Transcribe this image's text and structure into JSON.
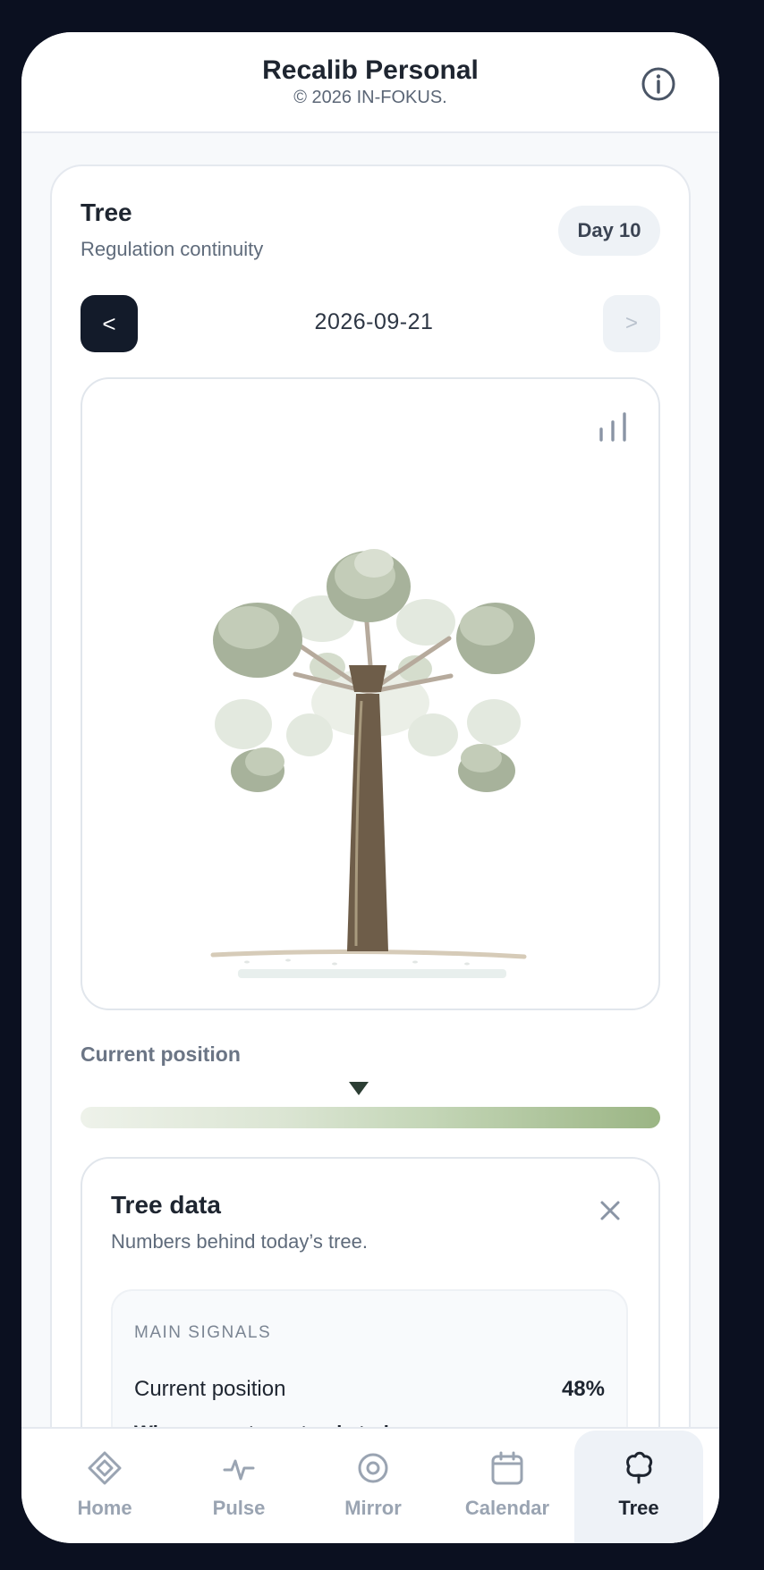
{
  "app": {
    "title": "Recalib Personal",
    "copyright": "© 2026 IN-FOKUS."
  },
  "tree_card": {
    "title": "Tree",
    "subtitle": "Regulation continuity",
    "day_badge": "Day 10",
    "prev_label": "<",
    "next_label": ">",
    "date": "2026-09-21"
  },
  "position": {
    "label": "Current position",
    "value_percent": 48
  },
  "tree_data": {
    "title": "Tree data",
    "subtitle": "Numbers behind today’s tree.",
    "section_heading": "MAIN SIGNALS",
    "signals": [
      {
        "name": "Current position",
        "value": "48%",
        "description": "Where your tree stands today."
      }
    ]
  },
  "tabbar": {
    "tabs": [
      {
        "label": "Home",
        "icon": "diamond-icon",
        "active": false
      },
      {
        "label": "Pulse",
        "icon": "pulse-icon",
        "active": false
      },
      {
        "label": "Mirror",
        "icon": "eye-icon",
        "active": false
      },
      {
        "label": "Calendar",
        "icon": "calendar-icon",
        "active": false
      },
      {
        "label": "Tree",
        "icon": "tree-icon",
        "active": true
      }
    ]
  },
  "colors": {
    "nav_dark": "#131b2a",
    "accent_green": "#9bb584",
    "trunk": "#6e5d49"
  }
}
